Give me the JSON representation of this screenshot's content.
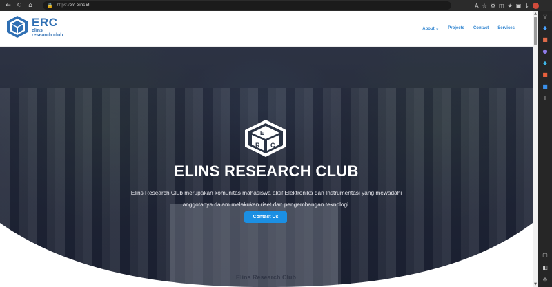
{
  "browser": {
    "url_protocol": "https://",
    "url_host": "erc.elins.id",
    "icons": [
      "back-arrow-icon",
      "refresh-icon",
      "home-icon",
      "lock-icon"
    ]
  },
  "header": {
    "logo_title": "ERC",
    "logo_sub1": "elins",
    "logo_sub2": "research club",
    "nav": [
      {
        "label": "About",
        "has_dropdown": true
      },
      {
        "label": "Projects"
      },
      {
        "label": "Contact"
      },
      {
        "label": "Services"
      }
    ]
  },
  "hero": {
    "title": "ELINS RESEARCH CLUB",
    "description_line1": "Elins Research Club merupakan komunitas mahasiswa aktif Elektronika dan Instrumentasi yang mewadahi",
    "description_line2": "anggotanya dalam melakukan riset dan pengembangan teknologi.",
    "cta_label": "Contact Us",
    "banner_text": "Elins Research Club"
  },
  "colors": {
    "brand": "#2f6fb3",
    "nav_link": "#2f84d0",
    "cta": "#1b8fe3"
  }
}
